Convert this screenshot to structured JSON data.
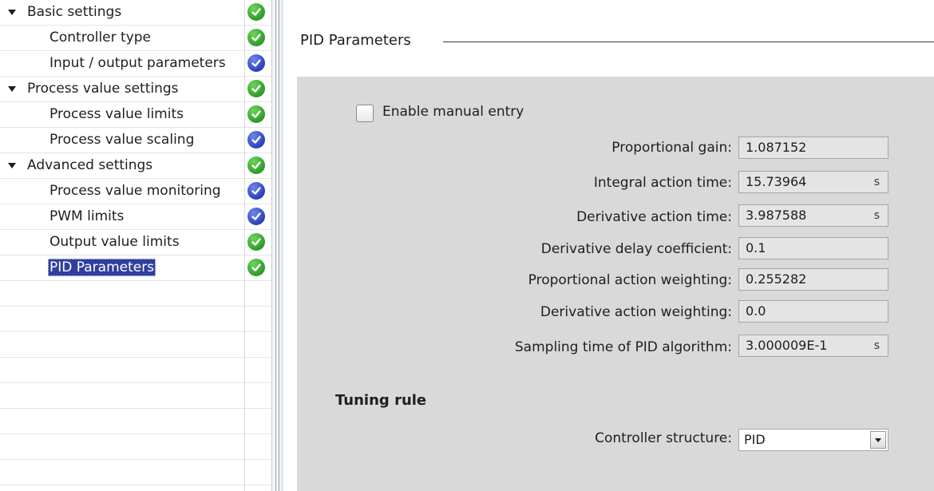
{
  "nav": {
    "items": [
      {
        "label": "Basic settings",
        "level": 0,
        "status": "ok"
      },
      {
        "label": "Controller type",
        "level": 1,
        "status": "ok"
      },
      {
        "label": "Input / output parameters",
        "level": 1,
        "status": "info"
      },
      {
        "label": "Process value settings",
        "level": 0,
        "status": "ok"
      },
      {
        "label": "Process value limits",
        "level": 1,
        "status": "ok"
      },
      {
        "label": "Process value scaling",
        "level": 1,
        "status": "info"
      },
      {
        "label": "Advanced settings",
        "level": 0,
        "status": "ok"
      },
      {
        "label": "Process value monitoring",
        "level": 1,
        "status": "info"
      },
      {
        "label": "PWM limits",
        "level": 1,
        "status": "info"
      },
      {
        "label": "Output value limits",
        "level": 1,
        "status": "ok"
      },
      {
        "label": "PID Parameters",
        "level": 1,
        "status": "ok",
        "selected": true
      }
    ]
  },
  "main": {
    "section_title": "PID Parameters",
    "manual_entry": {
      "label": "Enable manual entry",
      "checked": false
    },
    "params": [
      {
        "label": "Proportional gain:",
        "value": "1.087152",
        "unit": ""
      },
      {
        "label": "Integral action time:",
        "value": "15.73964",
        "unit": "s"
      },
      {
        "label": "Derivative action time:",
        "value": "3.987588",
        "unit": "s"
      },
      {
        "label": "Derivative delay coefficient:",
        "value": "0.1",
        "unit": ""
      },
      {
        "label": "Proportional action weighting:",
        "value": "0.255282",
        "unit": ""
      },
      {
        "label": "Derivative action weighting:",
        "value": "0.0",
        "unit": ""
      },
      {
        "label": "Sampling time of PID algorithm:",
        "value": "3.000009E-1",
        "unit": "s"
      }
    ],
    "tuning": {
      "title": "Tuning rule",
      "structure_label": "Controller structure:",
      "structure_value": "PID"
    }
  },
  "colors": {
    "ok": "#2e9a2a",
    "info": "#2a3fb8",
    "selection": "#2f3f9e",
    "panel_bg": "#d9d9d9"
  }
}
